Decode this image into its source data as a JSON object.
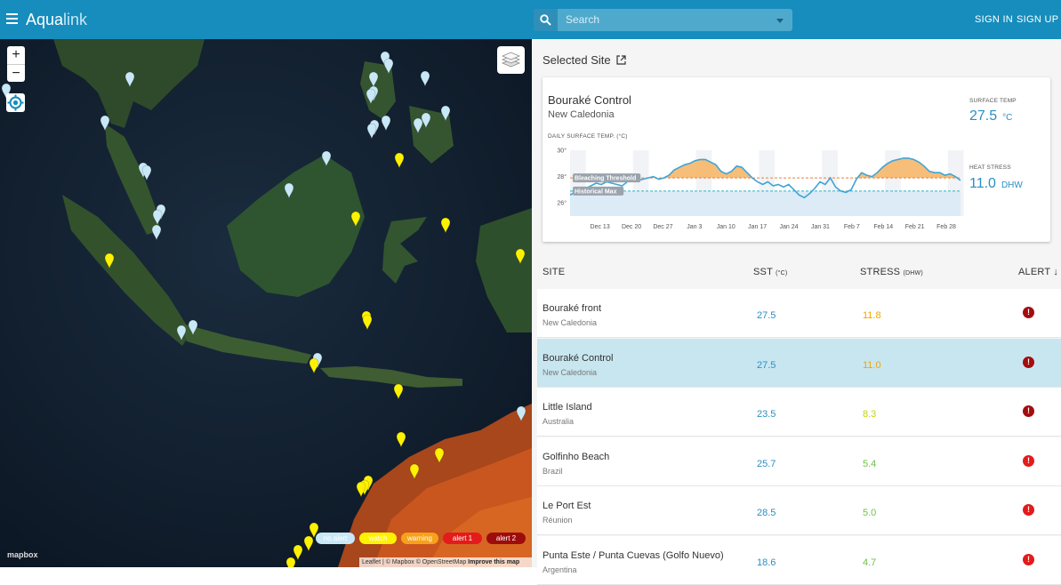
{
  "app": {
    "name_part1": "Aqua",
    "name_part2": "link"
  },
  "search": {
    "placeholder": "Search"
  },
  "auth": {
    "sign_in": "SIGN IN",
    "sign_up": "SIGN UP"
  },
  "map": {
    "zoom_in": "+",
    "zoom_out": "−",
    "legend": [
      {
        "label": "no alert",
        "color": "#c9e8f7",
        "text_color": "#ffffff"
      },
      {
        "label": "watch",
        "color": "#fff200",
        "text_color": "#ffffff"
      },
      {
        "label": "warning",
        "color": "#f7a11a",
        "text_color": "#ffffff"
      },
      {
        "label": "alert 1",
        "color": "#e31b1b",
        "text_color": "#ffffff"
      },
      {
        "label": "alert 2",
        "color": "#9e0b0b",
        "text_color": "#ffffff"
      }
    ],
    "mapbox_logo": "mapbox",
    "attribution": {
      "leaflet": "Leaflet",
      "sep1": " | © Mapbox © OpenStreetMap ",
      "improve": "Improve this map"
    }
  },
  "selected": {
    "heading": "Selected Site",
    "site_name": "Bouraké Control",
    "region": "New Caledonia",
    "chart_caption": "DAILY SURFACE TEMP. (°C)",
    "surface_temp_label": "SURFACE TEMP",
    "surface_temp_value": "27.5",
    "surface_temp_unit": "°C",
    "heat_stress_label": "HEAT STRESS",
    "heat_stress_value": "11.0",
    "heat_stress_unit": "DHW"
  },
  "chart_data": {
    "type": "area",
    "title": "",
    "ylabel": "DAILY SURFACE TEMP. (°C)",
    "y_ticks": [
      "30°",
      "28°",
      "26°"
    ],
    "ylim": [
      25,
      30
    ],
    "x_tick_labels": [
      "Dec 13",
      "Dec 20",
      "Dec 27",
      "Jan 3",
      "Jan 10",
      "Jan 17",
      "Jan 24",
      "Jan 31",
      "Feb 7",
      "Feb 14",
      "Feb 21",
      "Feb 28"
    ],
    "annotations": [
      "Bleaching Threshold",
      "Historical Max"
    ],
    "bleaching_threshold": 27.9,
    "historical_max": 26.9,
    "series": [
      {
        "values": [
          26.6,
          26.8,
          27.0,
          27.1,
          27.3,
          27.5,
          27.4,
          27.6,
          27.5,
          27.4,
          27.3,
          27.6,
          27.8,
          27.7,
          27.8,
          27.9,
          28.0,
          27.8,
          27.9,
          28.1,
          28.5,
          28.7,
          28.9,
          29.0,
          29.2,
          29.3,
          29.3,
          29.1,
          28.9,
          28.4,
          28.2,
          28.4,
          28.8,
          28.7,
          28.3,
          27.9,
          27.6,
          27.4,
          27.6,
          27.3,
          27.4,
          27.2,
          27.4,
          27.0,
          26.6,
          26.4,
          26.7,
          27.1,
          27.6,
          27.4,
          27.9,
          27.2,
          26.9,
          26.8,
          27.0,
          27.8,
          28.3,
          28.1,
          28.0,
          28.3,
          28.7,
          29.0,
          29.2,
          29.3,
          29.4,
          29.4,
          29.3,
          29.1,
          28.8,
          28.4,
          28.3,
          28.3,
          28.1,
          28.2,
          28.0,
          27.7
        ]
      }
    ]
  },
  "table": {
    "headers": {
      "site": "SITE",
      "sst": "SST",
      "sst_unit": "(°C)",
      "stress": "STRESS",
      "stress_unit": "(DHW)",
      "alert": "ALERT"
    },
    "rows": [
      {
        "name": "Bouraké front",
        "region": "New Caledonia",
        "sst": "27.5",
        "stress": "11.8",
        "stress_color": "#f0a500",
        "alert_color": "#a30d0d",
        "selected": false
      },
      {
        "name": "Bouraké Control",
        "region": "New Caledonia",
        "sst": "27.5",
        "stress": "11.0",
        "stress_color": "#f0a500",
        "alert_color": "#a30d0d",
        "selected": true
      },
      {
        "name": "Little Island",
        "region": "Australia",
        "sst": "23.5",
        "stress": "8.3",
        "stress_color": "#c8d400",
        "alert_color": "#a30d0d",
        "selected": false
      },
      {
        "name": "Golfinho Beach",
        "region": "Brazil",
        "sst": "25.7",
        "stress": "5.4",
        "stress_color": "#6fbf4a",
        "alert_color": "#e31b1b",
        "selected": false
      },
      {
        "name": "Le Port Est",
        "region": "Réunion",
        "sst": "28.5",
        "stress": "5.0",
        "stress_color": "#6fbf4a",
        "alert_color": "#e31b1b",
        "selected": false
      },
      {
        "name": "Punta Este / Punta Cuevas (Golfo Nuevo)",
        "region": "Argentina",
        "sst": "18.6",
        "stress": "4.7",
        "stress_color": "#6fbf4a",
        "alert_color": "#e31b1b",
        "selected": false
      }
    ]
  },
  "markers": {
    "watch_color": "#fff200",
    "no_alert_color": "#c9e8f7"
  }
}
